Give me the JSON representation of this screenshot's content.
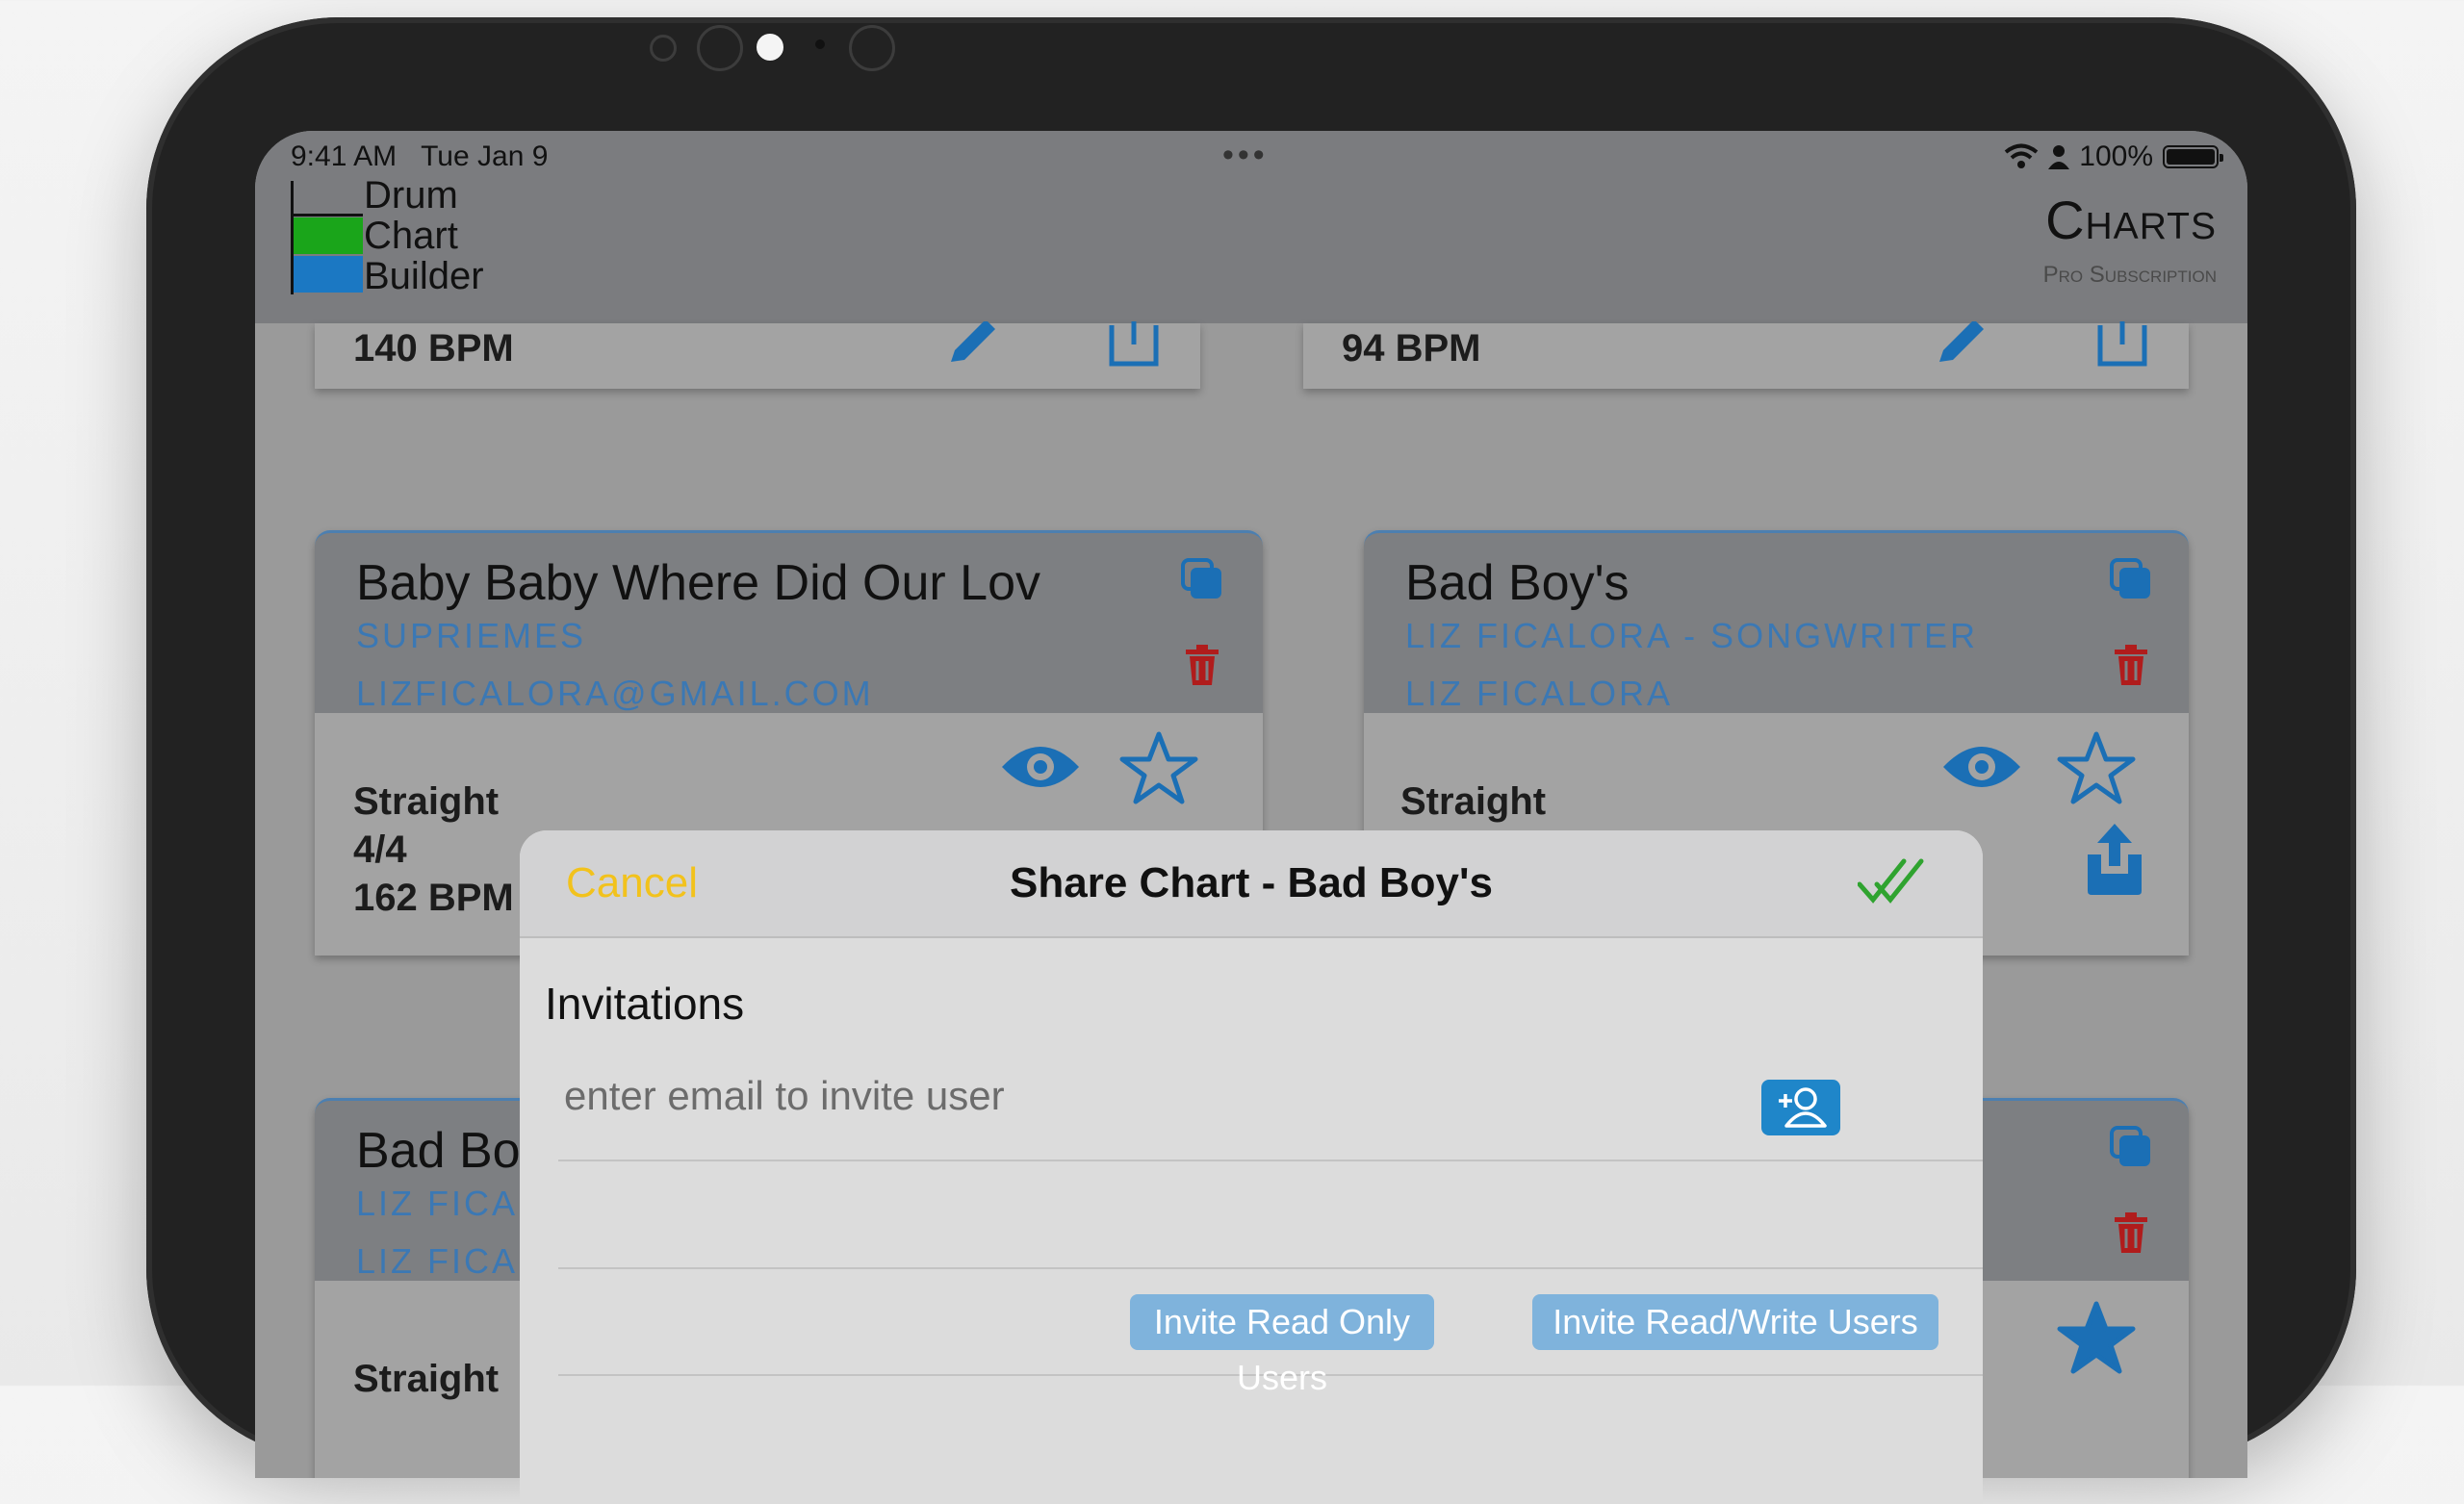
{
  "status_bar": {
    "time": "9:41 AM",
    "date": "Tue Jan 9",
    "dots": "•••",
    "battery": "100%",
    "battery_level": 1.0
  },
  "app": {
    "logo_lines": [
      "Drum",
      "Chart",
      "Builder"
    ],
    "logo_colors": [
      "#7b7c7f",
      "#1aa51a",
      "#1b78c3"
    ],
    "title": "Charts",
    "subtitle": "Pro Subscription"
  },
  "cards": [
    {
      "bpm": "140 BPM"
    },
    {
      "bpm": "94 BPM"
    },
    {
      "title": "Baby Baby Where Did Our Lov",
      "artist": "SUPRIEMES",
      "owner": "LIZFICALORA@GMAIL.COM",
      "style": "Straight",
      "time_sig": "4/4",
      "bpm": "162 BPM"
    },
    {
      "title": "Bad Boy's",
      "artist": "LIZ FICALORA - SONGWRITER",
      "owner": "LIZ FICALORA",
      "style": "Straight"
    },
    {
      "title": "Bad Bo",
      "artist": "LIZ FICAL",
      "owner": "LIZ FICAL",
      "style": "Straight"
    }
  ],
  "modal": {
    "cancel_label": "Cancel",
    "title": "Share Chart - Bad Boy's",
    "section_title": "Invitations",
    "email_placeholder": "enter email to invite user",
    "email_value": "",
    "invite_read_only_label": "Invite Read Only Users",
    "invite_read_write_label": "Invite Read/Write Users"
  },
  "colors": {
    "accent_blue": "#1f86c9",
    "icon_blue": "#1b6fb5",
    "delete_red": "#b01c1c",
    "cancel_yellow": "#f2c21c",
    "done_green": "#2fa32f"
  },
  "icons": [
    "wifi-icon",
    "person-icon",
    "battery-icon",
    "edit-icon",
    "share-icon",
    "copy-icon",
    "trash-icon",
    "eye-icon",
    "star-icon",
    "checkmark-icon",
    "add-person-icon"
  ]
}
